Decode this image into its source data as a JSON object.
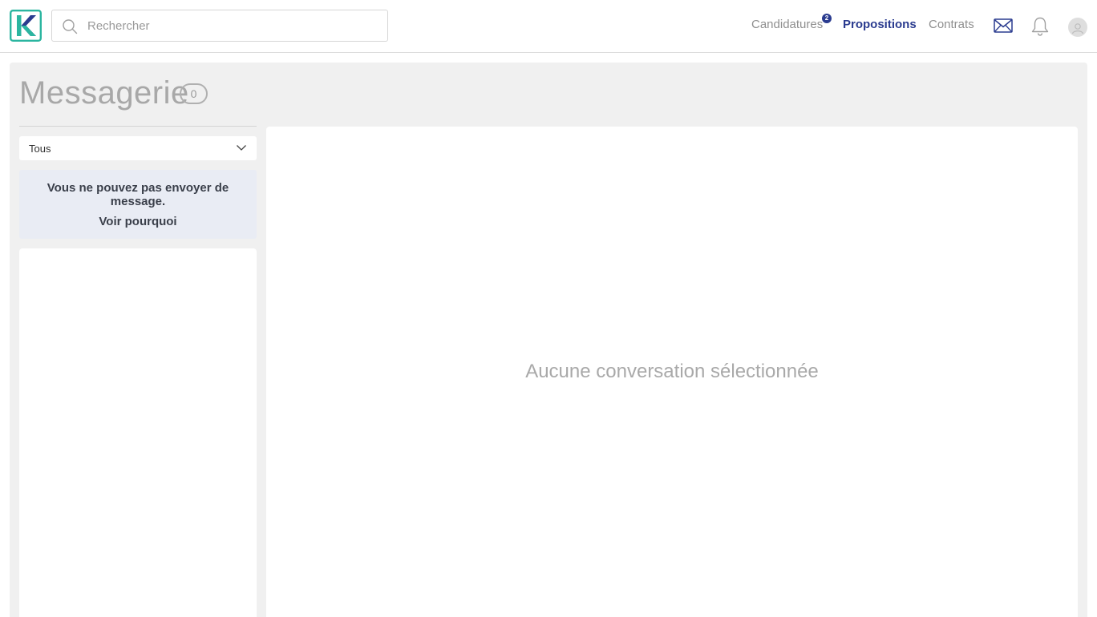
{
  "header": {
    "logo_letter": "K",
    "search": {
      "placeholder": "Rechercher",
      "value": ""
    },
    "nav": [
      {
        "label": "Candidatures",
        "badge": "2",
        "active": false
      },
      {
        "label": "Propositions",
        "active": true
      },
      {
        "label": "Contrats",
        "active": false
      }
    ],
    "icons": [
      "mail-icon",
      "bell-icon",
      "avatar-icon"
    ]
  },
  "page": {
    "title": "Messagerie",
    "count": "0"
  },
  "sidebar": {
    "filter": {
      "selected": "Tous"
    },
    "notice": {
      "text": "Vous ne pouvez pas envoyer de message.",
      "link": "Voir pourquoi"
    }
  },
  "conversation": {
    "empty_text": "Aucune conversation sélectionnée"
  },
  "colors": {
    "brand_primary": "#2a3b8f",
    "logo_teal": "#2bb5a0",
    "background": "#f0f0f0",
    "notice_bg": "#e9ecf4"
  }
}
